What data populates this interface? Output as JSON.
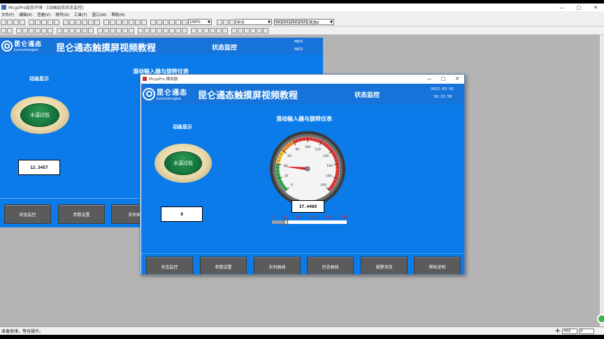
{
  "editor": {
    "title": "McgsPro组态环境 - [动画组态状态监控]",
    "window_controls": [
      "—",
      "□",
      "✕"
    ],
    "menu": [
      "文件(F)",
      "编辑(E)",
      "查看(V)",
      "排列(O)",
      "工具(T)",
      "窗口(W)",
      "帮助(H)"
    ],
    "toolbar": {
      "zoom": "100%",
      "language": "中文",
      "state_buttons": [
        "S0",
        "S1",
        "S2",
        "S3"
      ],
      "state_select": "状态0"
    },
    "status_message": "准备就绪，等待操作。",
    "coord_x": "432",
    "coord_y": "0"
  },
  "back_panel": {
    "logo_cn": "昆仑通态",
    "logo_en": "kunluntongtai",
    "title": "昆仑通态触摸屏视频教程",
    "subtitle": "状态监控",
    "date_placeholder": "ABCD",
    "time_placeholder": "ABCD",
    "animation_label": "动画显示",
    "lamp_text": "水温过低",
    "value": "12.3457",
    "slider_label": "滑动输入器与旋转仪表",
    "nav": [
      "状态监控",
      "参数设置",
      "实时曲"
    ]
  },
  "runtime": {
    "title": "McgsPro 模拟器",
    "window_controls": [
      "—",
      "□",
      "✕"
    ],
    "logo_cn": "昆仑通态",
    "logo_en": "kunluntongtai",
    "title_main": "昆仑通态触摸屏视频教程",
    "subtitle": "状态监控",
    "date": "2022-03-02",
    "time": "18:15:50",
    "animation_label": "动画显示",
    "lamp_text": "水温过低",
    "left_value": "0",
    "slider_label": "滑动输入器与旋转仪表",
    "gauge_value": "37.4468",
    "gauge": {
      "min": 0,
      "max": 200,
      "value": 37.4468,
      "tick_labels": [
        "0",
        "20",
        "40",
        "60",
        "80",
        "100",
        "120",
        "140",
        "160",
        "180",
        "200"
      ]
    },
    "slider": {
      "min": 0,
      "max": 200,
      "value": 37.4468,
      "tick_labels": [
        "0",
        "40",
        "80",
        "120",
        "160",
        "200"
      ]
    },
    "nav": [
      "状态监控",
      "参数设置",
      "实时曲线",
      "历史曲线",
      "报警浏览",
      "帮助说明"
    ]
  }
}
